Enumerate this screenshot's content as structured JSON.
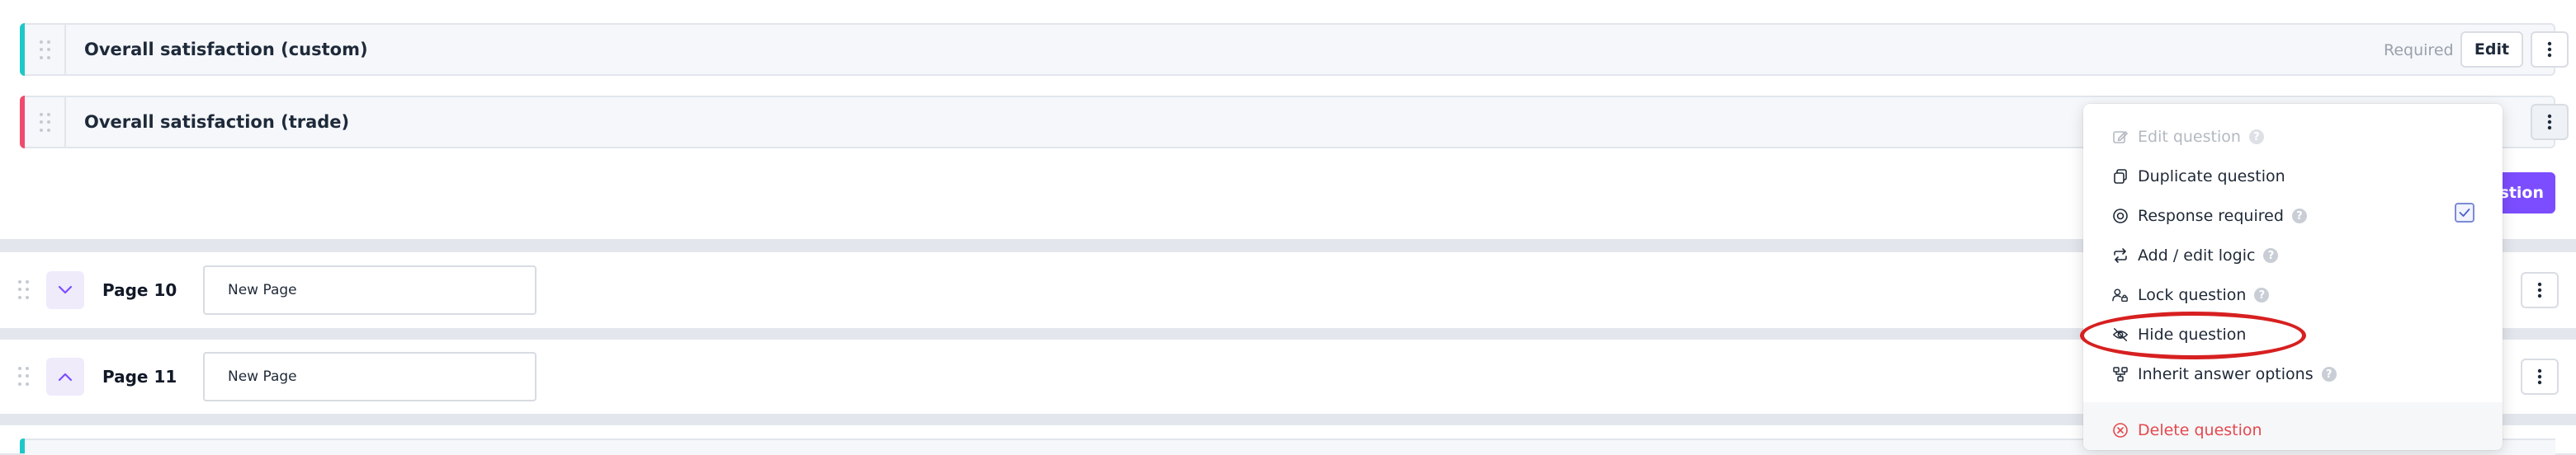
{
  "questions": [
    {
      "title": "Overall satisfaction (custom)",
      "required_label": "Required",
      "edit_label": "Edit",
      "accent": "#1ec8c8"
    },
    {
      "title": "Overall satisfaction (trade)",
      "accent": "#f04a6d"
    }
  ],
  "add_question_button": {
    "label": "estion"
  },
  "pages": [
    {
      "label": "Page 10",
      "name_value": "New Page",
      "expanded": false
    },
    {
      "label": "Page 11",
      "name_value": "New Page",
      "expanded": true
    }
  ],
  "menu": {
    "items": [
      {
        "label": "Edit question",
        "icon": "pencil-square-icon",
        "disabled": true,
        "help": true
      },
      {
        "label": "Duplicate question",
        "icon": "copy-icon"
      },
      {
        "label": "Response required",
        "icon": "target-icon",
        "help": true,
        "checked": true
      },
      {
        "label": "Add / edit logic",
        "icon": "repeat-arrows-icon",
        "help": true
      },
      {
        "label": "Lock question",
        "icon": "user-lock-icon",
        "help": true
      },
      {
        "label": "Hide question",
        "icon": "eye-off-icon"
      },
      {
        "label": "Inherit answer options",
        "icon": "hierarchy-icon",
        "help": true
      },
      {
        "label": "Delete question",
        "icon": "x-circle-icon",
        "danger": true
      }
    ],
    "help_glyph": "?"
  },
  "colors": {
    "accent_purple": "#7c4dff",
    "danger": "#e5484d",
    "annotation": "#d72020"
  }
}
